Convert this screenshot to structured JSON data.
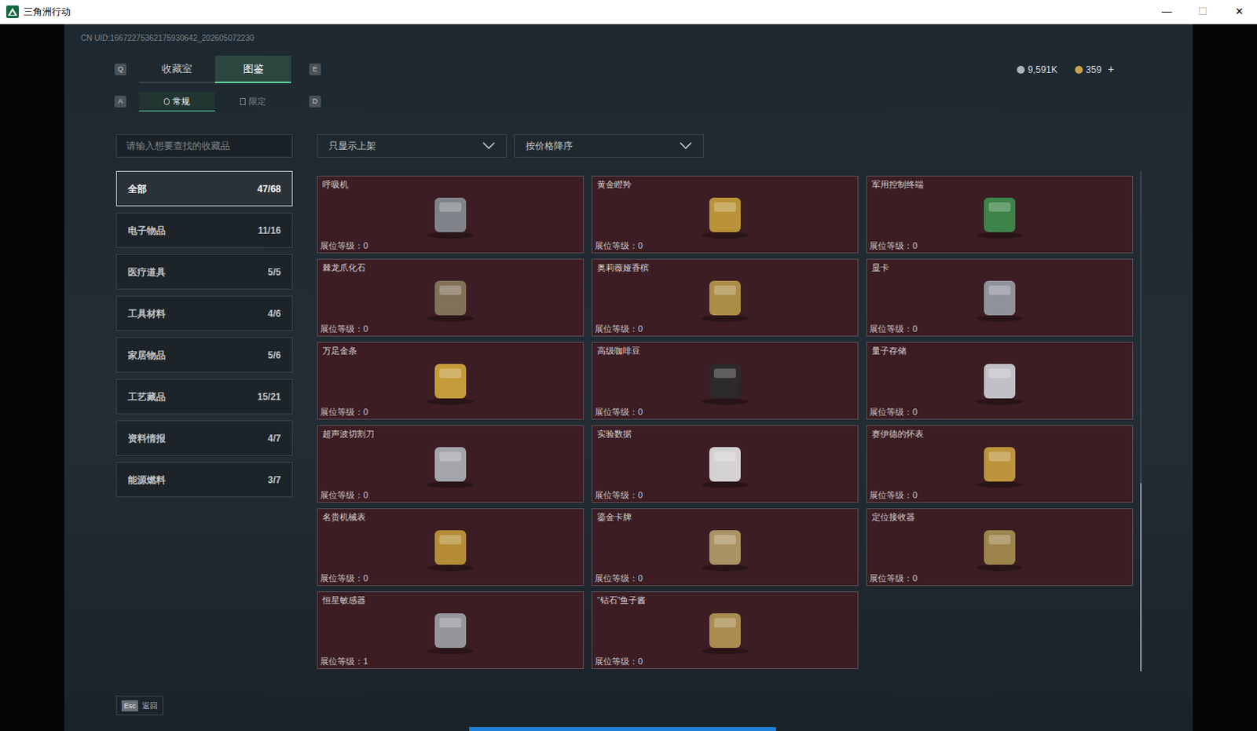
{
  "window": {
    "title": "三角洲行动",
    "controls": [
      "—",
      "☐",
      "✕"
    ]
  },
  "uid": "CN UID:16672275362175930642_202605072230",
  "tab_keys": [
    "Q",
    "E"
  ],
  "tabs": [
    {
      "label": "收藏室",
      "selected": false
    },
    {
      "label": "图鉴",
      "selected": true
    }
  ],
  "subtab_keys": [
    "A",
    "D"
  ],
  "subtabs": [
    {
      "label": "常规",
      "selected": true
    },
    {
      "label": "限定",
      "selected": false
    }
  ],
  "currency": [
    {
      "value": "9,591K",
      "action": ""
    },
    {
      "value": "359",
      "action": "+"
    }
  ],
  "search": {
    "placeholder": "请输入想要查找的收藏品"
  },
  "filters": [
    {
      "label": "只显示上架"
    },
    {
      "label": "按价格降序"
    }
  ],
  "categories": [
    {
      "label": "全部",
      "count": "47/68",
      "selected": true
    },
    {
      "label": "电子物品",
      "count": "11/16",
      "selected": false
    },
    {
      "label": "医疗道具",
      "count": "5/5",
      "selected": false
    },
    {
      "label": "工具材料",
      "count": "4/6",
      "selected": false
    },
    {
      "label": "家居物品",
      "count": "5/6",
      "selected": false
    },
    {
      "label": "工艺藏品",
      "count": "15/21",
      "selected": false
    },
    {
      "label": "资料情报",
      "count": "4/7",
      "selected": false
    },
    {
      "label": "能源燃料",
      "count": "3/7",
      "selected": false
    }
  ],
  "level_label": "展位等级：",
  "items": [
    {
      "name": "呼吸机",
      "level": "0"
    },
    {
      "name": "黄金瞪羚",
      "level": "0"
    },
    {
      "name": "军用控制终端",
      "level": "0"
    },
    {
      "name": "棘龙爪化石",
      "level": "0"
    },
    {
      "name": "奥莉薇娅香槟",
      "level": "0"
    },
    {
      "name": "显卡",
      "level": "0"
    },
    {
      "name": "万足金条",
      "level": "0"
    },
    {
      "name": "高级咖啡豆",
      "level": "0"
    },
    {
      "name": "量子存储",
      "level": "0"
    },
    {
      "name": "超声波切割刀",
      "level": "0"
    },
    {
      "name": "实验数据",
      "level": "0"
    },
    {
      "name": "赛伊德的怀表",
      "level": "0"
    },
    {
      "name": "名贵机械表",
      "level": "0"
    },
    {
      "name": "鎏金卡牌",
      "level": "0"
    },
    {
      "name": "定位接收器",
      "level": "0"
    },
    {
      "name": "恒星敏感器",
      "level": "1"
    },
    {
      "name": "“钻石”鱼子酱",
      "level": "0"
    }
  ],
  "footer": {
    "key": "Esc",
    "label": "返回"
  }
}
